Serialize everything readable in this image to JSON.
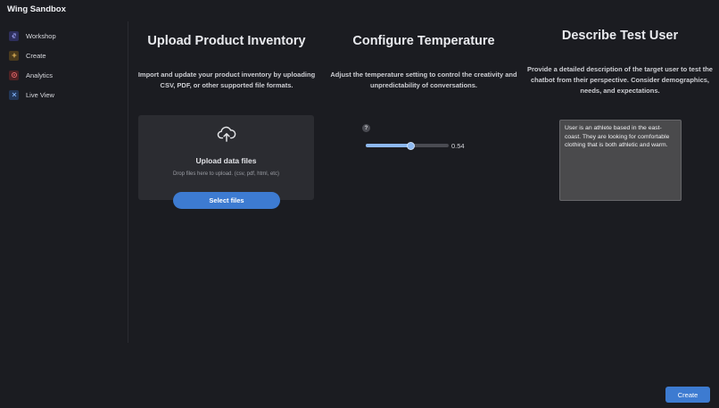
{
  "app": {
    "title": "Wing Sandbox"
  },
  "sidebar": {
    "items": [
      {
        "label": "Workshop",
        "icon": "link-icon",
        "color": "#6b6fe0"
      },
      {
        "label": "Create",
        "icon": "plus-icon",
        "color": "#d9a94a"
      },
      {
        "label": "Analytics",
        "icon": "target-icon",
        "color": "#e0575b"
      },
      {
        "label": "Live View",
        "icon": "network-icon",
        "color": "#5b8fe0"
      }
    ]
  },
  "upload": {
    "title": "Upload Product Inventory",
    "description_line1": "Import and update your product inventory by uploading",
    "description_line2": "CSV, PDF, or other supported file formats.",
    "card_title": "Upload data files",
    "card_hint": "Drop files here to upload. (csv, pdf, html, etc)",
    "button_label": "Select files"
  },
  "temperature": {
    "title": "Configure Temperature",
    "description_line1": "Adjust the temperature setting to control the creativity and",
    "description_line2": "unpredictability of conversations.",
    "help_symbol": "?",
    "value": 0.54,
    "value_label": "0.54"
  },
  "test_user": {
    "title": "Describe Test User",
    "description_line1": "Provide a detailed description of the target user to test the",
    "description_line2": "chatbot from their perspective. Consider demographics,",
    "description_line3": "needs, and expectations.",
    "text": "User is an athlete based in the east-coast. They are looking for comfortable clothing that is both athletic and warm."
  },
  "footer": {
    "create_label": "Create"
  },
  "colors": {
    "accent": "#3d7bd1",
    "slider": "#8db8f0",
    "background": "#1b1c21"
  }
}
